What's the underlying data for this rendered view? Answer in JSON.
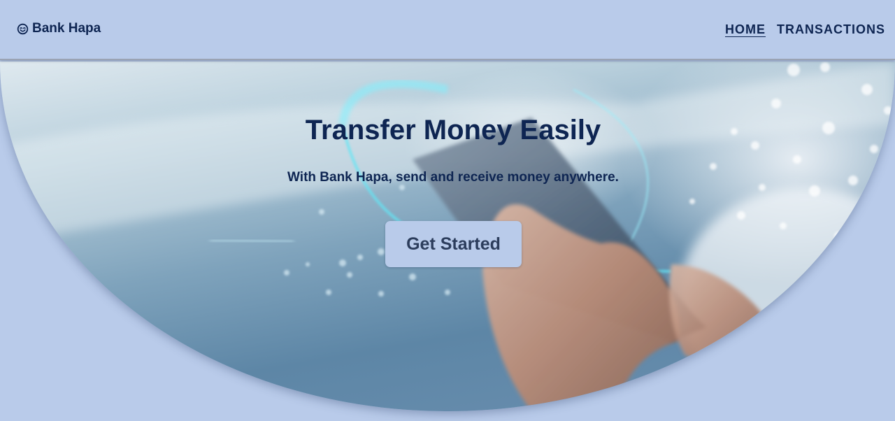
{
  "navbar": {
    "brand": {
      "label": "Bank Hapa",
      "icon": "smile-circle-icon"
    },
    "links": [
      {
        "label": "HOME",
        "active": true
      },
      {
        "label": "TRANSACTIONS",
        "active": false
      }
    ]
  },
  "hero": {
    "title": "Transfer Money Easily",
    "subtitle": "With Bank Hapa, send and receive money anywhere.",
    "cta_label": "Get Started"
  },
  "colors": {
    "background": "#b9cbea",
    "text_primary": "#0e2552",
    "button_bg": "#b9cbea",
    "button_text": "#2c3d5c"
  }
}
